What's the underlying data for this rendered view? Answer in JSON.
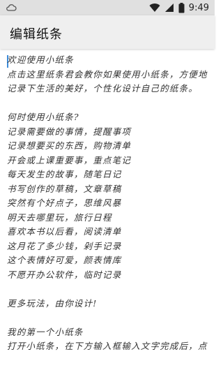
{
  "status_bar": {
    "time": "9:49",
    "icons": [
      "cloud-icon",
      "wifi-icon",
      "signal-icon",
      "battery-icon"
    ]
  },
  "app_bar": {
    "title": "编辑纸条"
  },
  "editor": {
    "lines": [
      "欢迎使用小纸条",
      "点击这里纸条君会教你如果使用小纸条，方便地",
      "记录下生活的美好，个性化设计自己的纸条。",
      "",
      "何时使用小纸条?",
      "记录需要做的事情，提醒事项",
      "记录想要买的东西，购物清单",
      "开会或上课重要事，重点笔记",
      "每天发生的故事，随笔日记",
      "书写创作的草稿，文章草稿",
      "突然有个好点子，思维风暴",
      "明天去哪里玩，旅行日程",
      "喜欢本书以后看，阅读清单",
      "这月花了多少钱，剁手记录",
      "这个表情好可爱，颜表情库",
      "不愿开办公软件，临时记录",
      "",
      "更多玩法，由你设计!",
      "",
      "我的第一个小纸条",
      "打开小纸条，在下方输入框输入文字完成后，点"
    ]
  }
}
